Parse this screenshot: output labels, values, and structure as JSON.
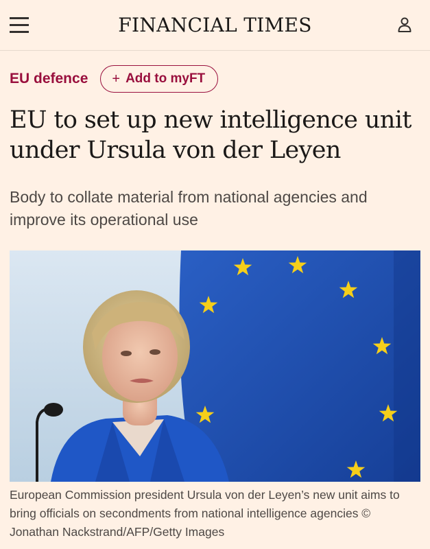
{
  "header": {
    "brand": "FINANCIAL TIMES",
    "menu_icon": "hamburger-menu-icon",
    "user_icon": "user-icon"
  },
  "article": {
    "topic": "EU defence",
    "myft_plus": "+",
    "myft_label": "Add to myFT",
    "headline": "EU to set up new intelligence unit under Ursula von der Leyen",
    "standfirst": "Body to collate material from national agencies and improve its operational use",
    "caption": "European Commission president Ursula von der Leyen’s new unit aims to bring officials on secondments from national intelligence agencies © Jonathan Nackstrand/AFP/Getty Images"
  },
  "colors": {
    "background": "#fff1e5",
    "accent": "#990f3d",
    "text": "#33302e",
    "flag_blue": "#1d4fb0",
    "flag_star": "#f6cf1a"
  }
}
